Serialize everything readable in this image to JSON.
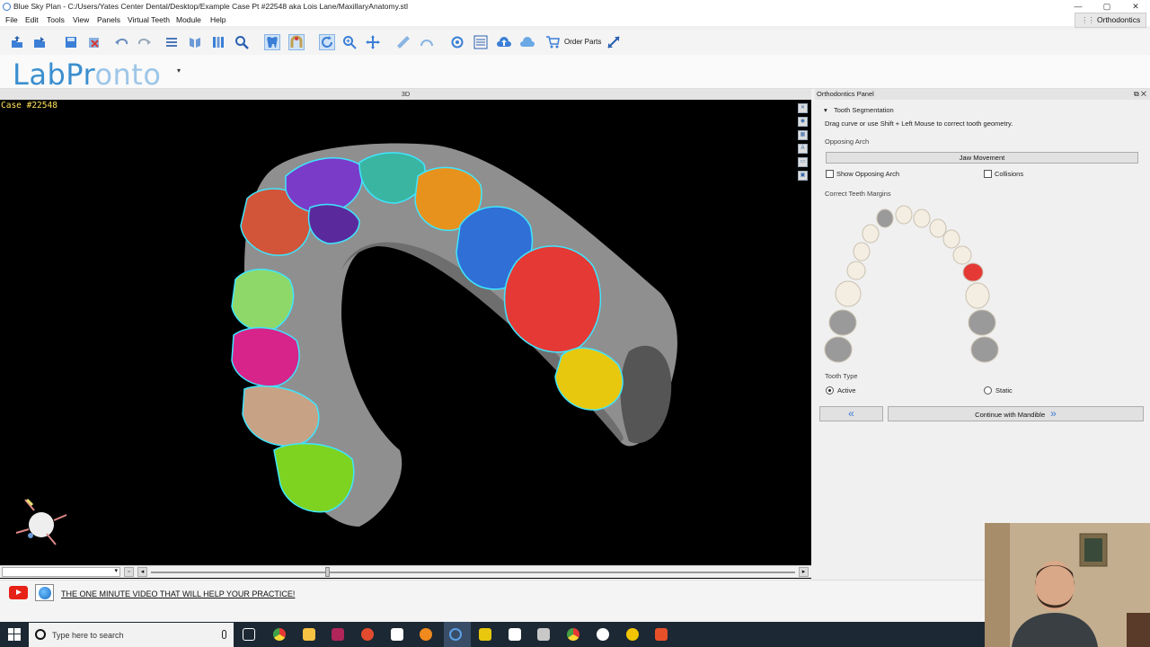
{
  "window": {
    "title": "Blue Sky Plan - C:/Users/Yates Center Dental/Desktop/Example Case Pt #22548 aka Lois Lane/MaxillaryAnatomy.stl",
    "controls": [
      "—",
      "▢",
      "✕"
    ]
  },
  "menu": [
    "File",
    "Edit",
    "Tools",
    "View",
    "Panels",
    "Virtual Teeth",
    "Module",
    "Help"
  ],
  "mode_selector": "Orthodontics",
  "toolbar": {
    "order_parts_label": "Order Parts"
  },
  "brand": {
    "logo_text_a": "LabPr",
    "logo_text_o": "o",
    "logo_text_b": "nto",
    "dropdown": "▾"
  },
  "viewport": {
    "title": "3D",
    "case_label": "Case #22548"
  },
  "panel": {
    "title": "Orthodontics Panel",
    "section": "Tooth Segmentation",
    "hint": "Drag curve or use Shift + Left Mouse to correct tooth geometry.",
    "opposing_arch_label": "Opposing Arch",
    "jaw_movement_button": "Jaw Movement",
    "show_opposing_arch": "Show Opposing Arch",
    "collisions": "Collisions",
    "correct_margins_label": "Correct Teeth Margins",
    "tooth_type_label": "Tooth Type",
    "tooth_type_options": [
      "Active",
      "Static"
    ],
    "tooth_type_selected": "Active",
    "back_button": "«",
    "continue_button": "Continue with Mandible",
    "continue_arrow": "»"
  },
  "status": {
    "promo_text": "THE ONE MINUTE VIDEO THAT WILL HELP YOUR PRACTICE!"
  },
  "taskbar": {
    "search_placeholder": "Type here to search"
  },
  "colors": {
    "accent": "#3b7fd6",
    "case_label": "#ffe35a",
    "selected_tooth": "#e53935"
  }
}
